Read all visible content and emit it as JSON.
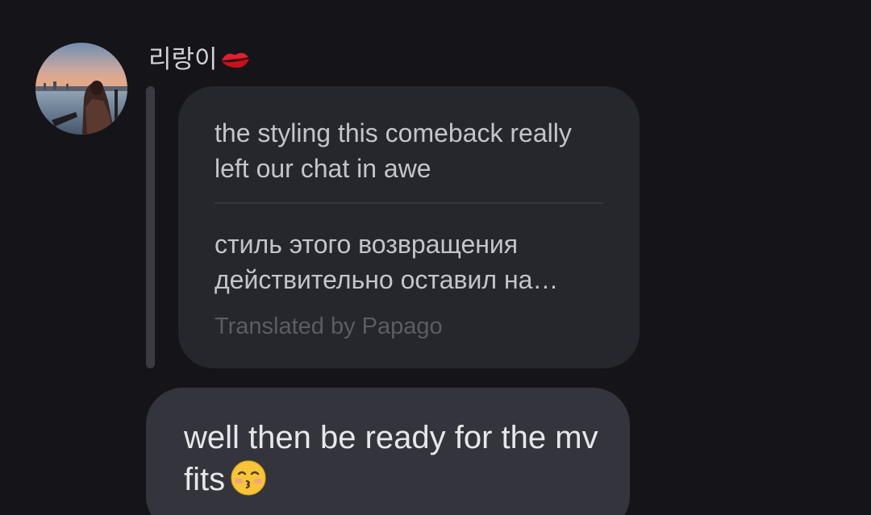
{
  "message": {
    "sender_name": "리랑이",
    "sender_badge_icon": "kiss-mark-icon",
    "reply": {
      "original_text": "the styling this comeback really left our chat in awe",
      "translation_line1": "стиль этого возвращения",
      "translation_line2": "действительно оставил на…",
      "translated_by": "Translated by Papago"
    },
    "body_text": "well then be ready for the mv fits",
    "body_emoji_icon": "kissing-face-icon"
  },
  "colors": {
    "background": "#151519",
    "reply_bubble": "#26272c",
    "message_bubble": "#34353c",
    "text_primary": "#e6e7ea",
    "text_muted": "#5a5c66"
  }
}
